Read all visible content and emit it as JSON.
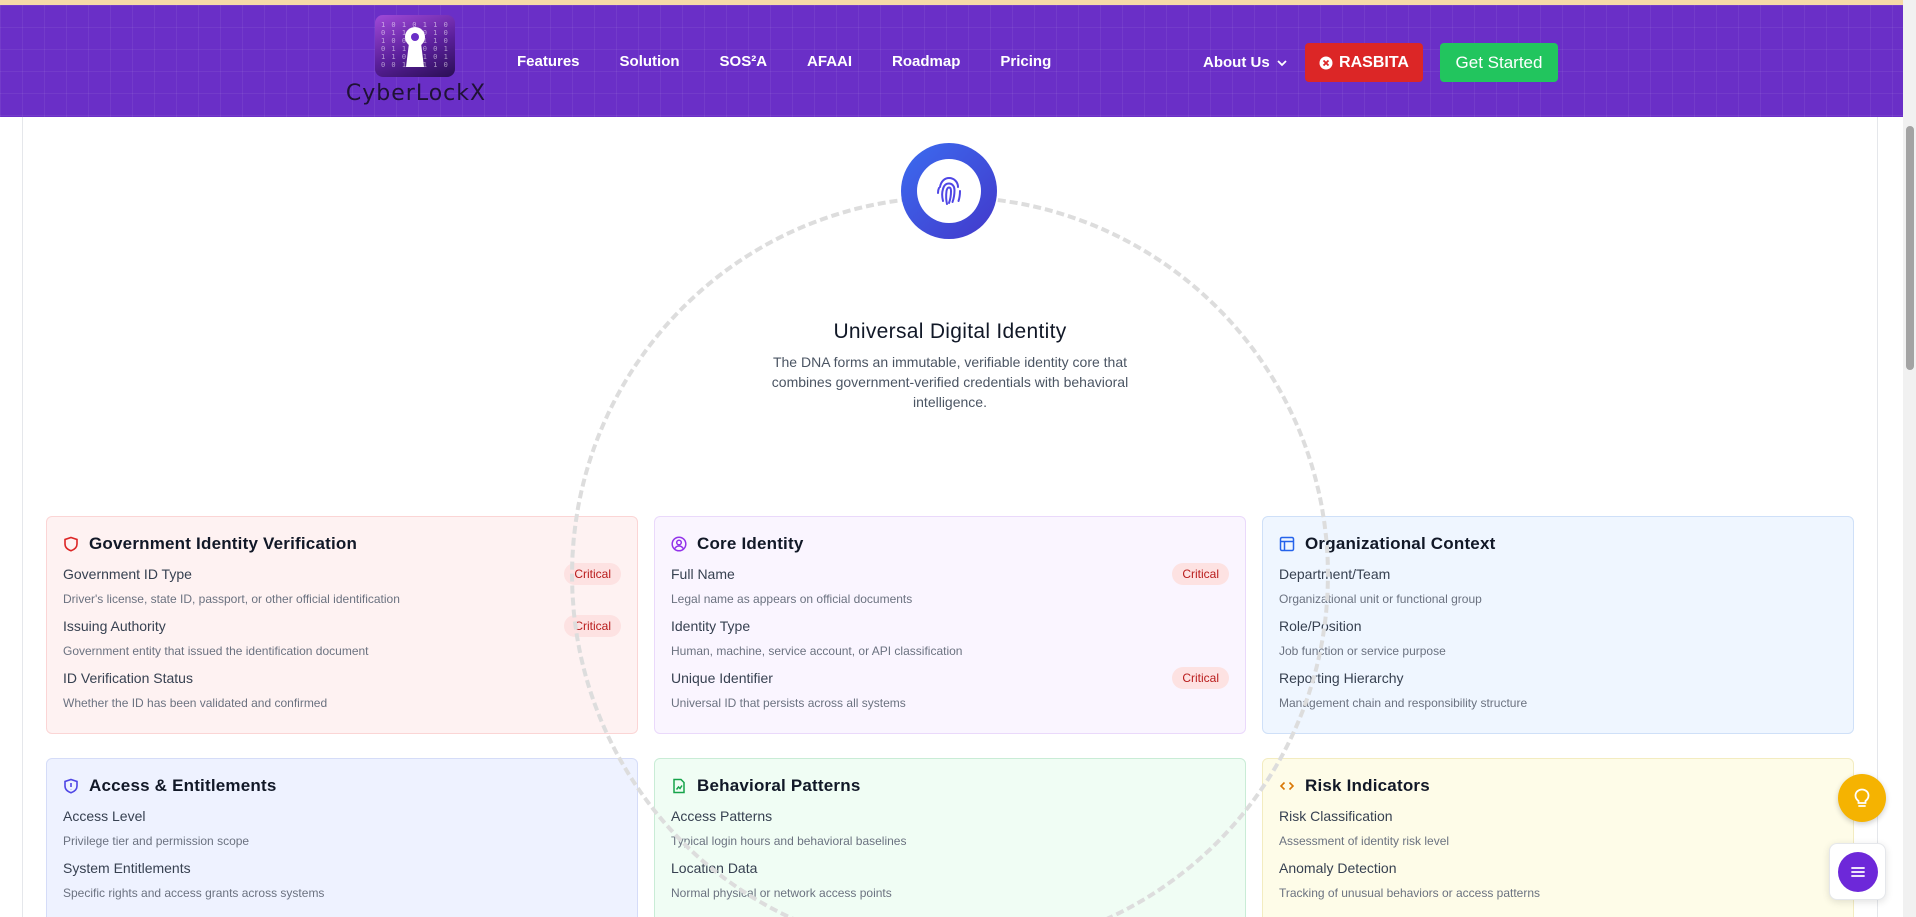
{
  "nav": {
    "logo_text": "CyberLockX",
    "links": [
      "Features",
      "Solution",
      "SOS²A",
      "AFAAI",
      "Roadmap",
      "Pricing"
    ],
    "about_label": "About Us",
    "rasbita_label": "RASBITA",
    "get_started_label": "Get Started"
  },
  "hub": {
    "icon": "fingerprint-icon",
    "title": "Universal Digital Identity",
    "description": "The DNA forms an immutable, verifiable identity core that combines government-verified credentials with behavioral intelligence."
  },
  "cards": [
    {
      "title": "Government Identity Verification",
      "icon": "shield-icon",
      "color": "#dc2626",
      "fields": [
        {
          "name": "Government ID Type",
          "desc": "Driver's license, state ID, passport, or other official identification",
          "badge": "Critical"
        },
        {
          "name": "Issuing Authority",
          "desc": "Government entity that issued the identification document",
          "badge": "Critical"
        },
        {
          "name": "ID Verification Status",
          "desc": "Whether the ID has been validated and confirmed",
          "badge": ""
        }
      ]
    },
    {
      "title": "Core Identity",
      "icon": "user-circle-icon",
      "color": "#9333ea",
      "fields": [
        {
          "name": "Full Name",
          "desc": "Legal name as appears on official documents",
          "badge": "Critical"
        },
        {
          "name": "Identity Type",
          "desc": "Human, machine, service account, or API classification",
          "badge": ""
        },
        {
          "name": "Unique Identifier",
          "desc": "Universal ID that persists across all systems",
          "badge": "Critical"
        }
      ]
    },
    {
      "title": "Organizational Context",
      "icon": "layout-icon",
      "color": "#2563eb",
      "fields": [
        {
          "name": "Department/Team",
          "desc": "Organizational unit or functional group",
          "badge": ""
        },
        {
          "name": "Role/Position",
          "desc": "Job function or service purpose",
          "badge": ""
        },
        {
          "name": "Reporting Hierarchy",
          "desc": "Management chain and responsibility structure",
          "badge": ""
        }
      ]
    },
    {
      "title": "Access & Entitlements",
      "icon": "shield-check-icon",
      "color": "#4f46e5",
      "fields": [
        {
          "name": "Access Level",
          "desc": "Privilege tier and permission scope",
          "badge": ""
        },
        {
          "name": "System Entitlements",
          "desc": "Specific rights and access grants across systems",
          "badge": ""
        }
      ]
    },
    {
      "title": "Behavioral Patterns",
      "icon": "file-chart-icon",
      "color": "#16a34a",
      "fields": [
        {
          "name": "Access Patterns",
          "desc": "Typical login hours and behavioral baselines",
          "badge": ""
        },
        {
          "name": "Location Data",
          "desc": "Normal physical or network access points",
          "badge": ""
        }
      ]
    },
    {
      "title": "Risk Indicators",
      "icon": "code-icon",
      "color": "#d97706",
      "fields": [
        {
          "name": "Risk Classification",
          "desc": "Assessment of identity risk level",
          "badge": ""
        },
        {
          "name": "Anomaly Detection",
          "desc": "Tracking of unusual behaviors or access patterns",
          "badge": ""
        }
      ]
    }
  ],
  "floating": {
    "idea_icon": "lightbulb-icon",
    "menu_icon": "menu-icon"
  }
}
